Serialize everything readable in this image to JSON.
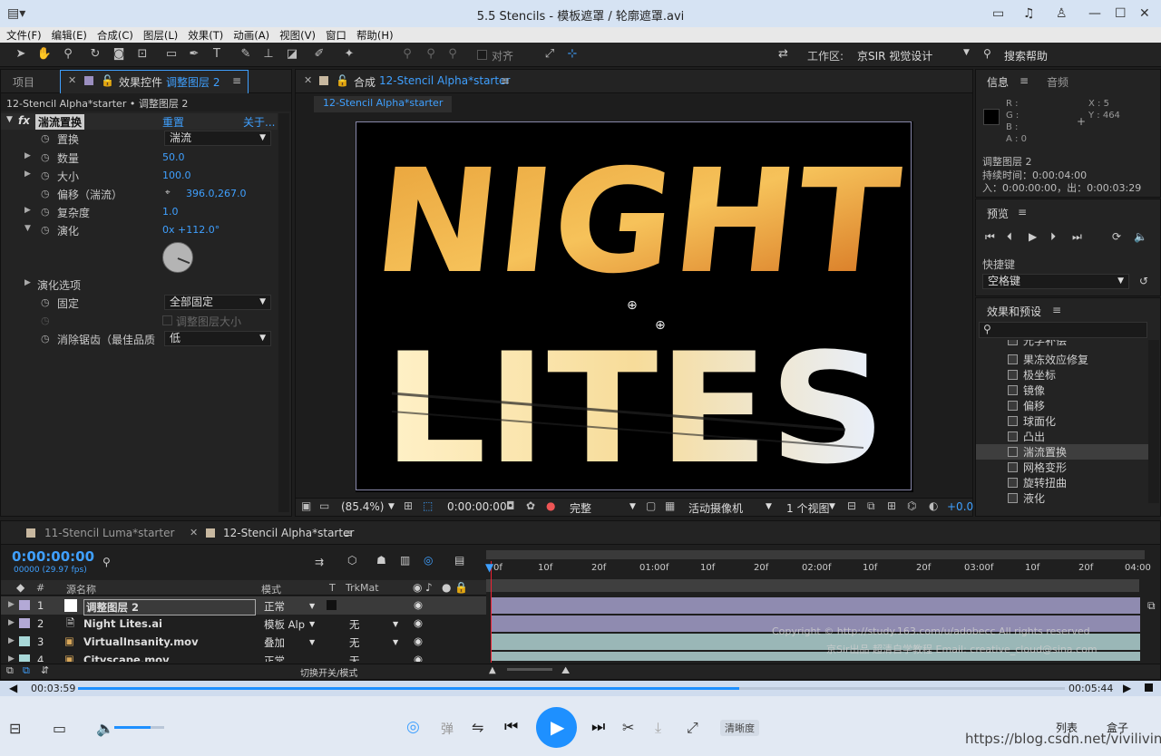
{
  "window": {
    "title": "5.5 Stencils - 模板遮罩 / 轮廓遮罩.avi"
  },
  "menu": [
    "文件(F)",
    "编辑(E)",
    "合成(C)",
    "图层(L)",
    "效果(T)",
    "动画(A)",
    "视图(V)",
    "窗口",
    "帮助(H)"
  ],
  "toolbar": {
    "align_label": "对齐",
    "workspace_label": "工作区:",
    "workspace_value": "京SIR 视觉设计",
    "search_help": "搜索帮助"
  },
  "left_panel": {
    "tab_project": "项目",
    "tab_effects_prefix": "效果控件",
    "tab_effects_layer": "调整图层 2",
    "breadcrumb": "12-Stencil Alpha*starter • 调整图层 2",
    "effect_name": "湍流置换",
    "reset": "重置",
    "about": "关于...",
    "props": [
      {
        "label": "置换",
        "dropdown": "湍流"
      },
      {
        "label": "数量",
        "value": "50.0"
      },
      {
        "label": "大小",
        "value": "100.0"
      },
      {
        "label": "偏移（湍流）",
        "value": "396.0,267.0"
      },
      {
        "label": "复杂度",
        "value": "1.0"
      },
      {
        "label": "演化",
        "value": "0x +112.0°"
      },
      {
        "label": "演化选项"
      },
      {
        "label": "固定",
        "dropdown": "全部固定"
      },
      {
        "label": "",
        "checkbox": "调整图层大小"
      },
      {
        "label": "消除锯齿（最佳品质",
        "dropdown": "低"
      }
    ]
  },
  "comp_panel": {
    "tab_label": "合成",
    "tab_comp": "12-Stencil Alpha*starter",
    "chip": "12-Stencil Alpha*starter",
    "art_line1": "NIGHT",
    "art_line2": "LITES",
    "footer": {
      "zoom": "(85.4%)",
      "timecode": "0:00:00:00",
      "quality": "完整",
      "camera": "活动摄像机",
      "views": "1 个视图",
      "exposure": "+0.0"
    }
  },
  "info_panel": {
    "tab_info": "信息",
    "tab_audio": "音频",
    "r": "R :",
    "g": "G :",
    "b": "B :",
    "a": "A : 0",
    "x": "X : 5",
    "y": "Y : 464",
    "layer": "调整图层 2",
    "duration": "持续时间：0:00:04:00",
    "inout": "入：0:00:00:00，出：0:00:03:29"
  },
  "preview_panel": {
    "title": "预览",
    "shortcut_label": "快捷键",
    "shortcut_value": "空格键"
  },
  "effects_panel": {
    "title": "效果和预设",
    "items": [
      "光学补偿",
      "果冻效应修复",
      "极坐标",
      "镜像",
      "偏移",
      "球面化",
      "凸出",
      "湍流置换",
      "网格变形",
      "旋转扭曲",
      "液化"
    ],
    "selected": "湍流置换"
  },
  "timeline": {
    "tab1": "11-Stencil Luma*starter",
    "tab2": "12-Stencil Alpha*starter",
    "timecode": "0:00:00:00",
    "fps": "00000 (29.97 fps)",
    "col_num": "#",
    "col_name": "源名称",
    "col_mode": "模式",
    "col_t": "T",
    "col_trkmat": "TrkMat",
    "ruler": [
      "0f",
      "10f",
      "20f",
      "01:00f",
      "10f",
      "20f",
      "02:00f",
      "10f",
      "20f",
      "03:00f",
      "10f",
      "20f",
      "04:00"
    ],
    "layers": [
      {
        "num": "1",
        "name": "调整图层 2",
        "mode": "正常",
        "trk": ""
      },
      {
        "num": "2",
        "name": "Night Lites.ai",
        "mode": "模板 Alp",
        "trk": "无"
      },
      {
        "num": "3",
        "name": "VirtualInsanity.mov",
        "mode": "叠加",
        "trk": "无"
      },
      {
        "num": "4",
        "name": "Cityscape.mov",
        "mode": "正常",
        "trk": "无"
      }
    ],
    "switch_modes": "切换开关/模式",
    "copyright1": "Copyright © http://study.163.com/u/adobecc All rights reserved",
    "copyright2": "京Sir出品 超清自学教程 Email: creative_cloud@sina.com"
  },
  "player": {
    "time_current": "00:03:59",
    "time_total": "00:05:44",
    "progress": 0.67,
    "bullet": "弹",
    "quality": "清晰度",
    "list": "列表",
    "box": "盒子",
    "watermark": "https://blog.csdn.net/viviliving"
  },
  "colors": {
    "accent": "#3fa0ff",
    "layer_bar": "#8f8bb0",
    "player_blue": "#1e90ff"
  }
}
